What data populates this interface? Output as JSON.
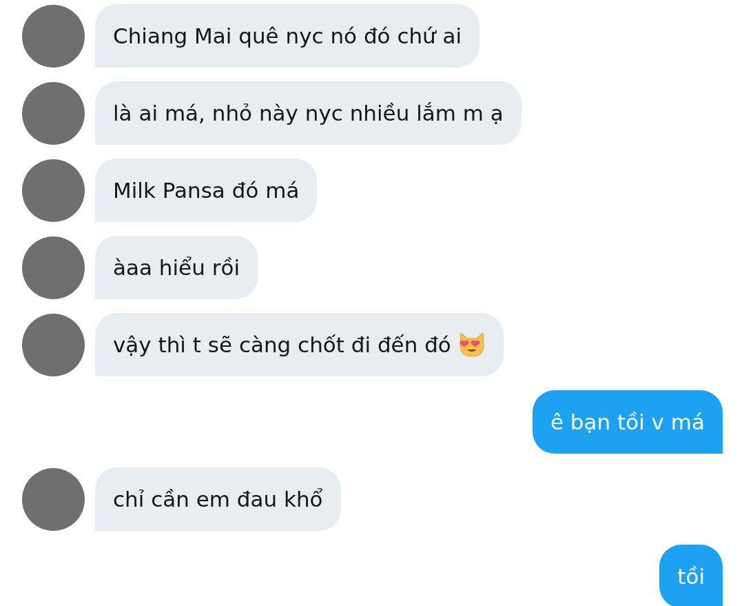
{
  "messages": [
    {
      "kind": "received",
      "text": "Chiang Mai quê nyc nó đó chứ ai"
    },
    {
      "kind": "received",
      "text": "là ai má, nhỏ này nyc nhiều lắm m ạ"
    },
    {
      "kind": "received",
      "text": "Milk Pansa đó má"
    },
    {
      "kind": "received",
      "text": "àaa hiểu rồi"
    },
    {
      "kind": "received_emoji",
      "text": "vậy thì t sẽ càng chốt đi đến đó"
    },
    {
      "kind": "sent",
      "text": "ê bạn tồi v má"
    },
    {
      "kind": "received",
      "text": "chỉ cần em đau khổ"
    },
    {
      "kind": "sent",
      "text": "tồi"
    }
  ]
}
